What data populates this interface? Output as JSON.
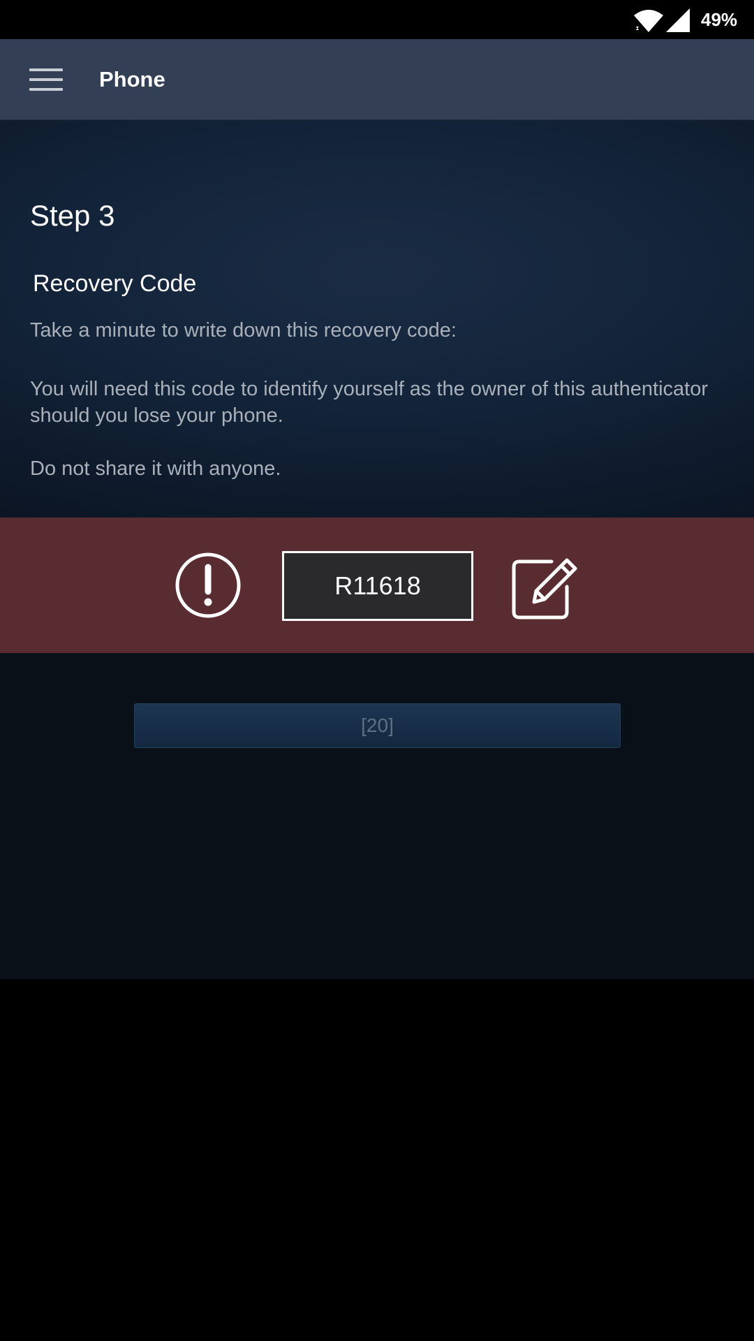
{
  "status_bar": {
    "battery": "49%",
    "icons": [
      "wifi-icon",
      "cell-signal-icon"
    ]
  },
  "app_bar": {
    "title": "Phone",
    "menu_icon": "hamburger-menu-icon"
  },
  "content": {
    "step_title": "Step 3",
    "section_title": "Recovery Code",
    "instructions": [
      "Take a minute to write down this recovery code:",
      "You will need this code to identify yourself as the owner of this authenticator should you lose your phone.",
      "Do not share it with anyone."
    ]
  },
  "recovery": {
    "code": "R11618",
    "left_icon": "alert-circle-icon",
    "right_icon": "edit-icon",
    "band_color": "#582c30"
  },
  "countdown_button": {
    "label": "[20]"
  },
  "colors": {
    "app_bar": "#323f54",
    "content_bg": "#13243a",
    "lower_bg": "#0a1017",
    "button_bg": "#1c3551"
  }
}
